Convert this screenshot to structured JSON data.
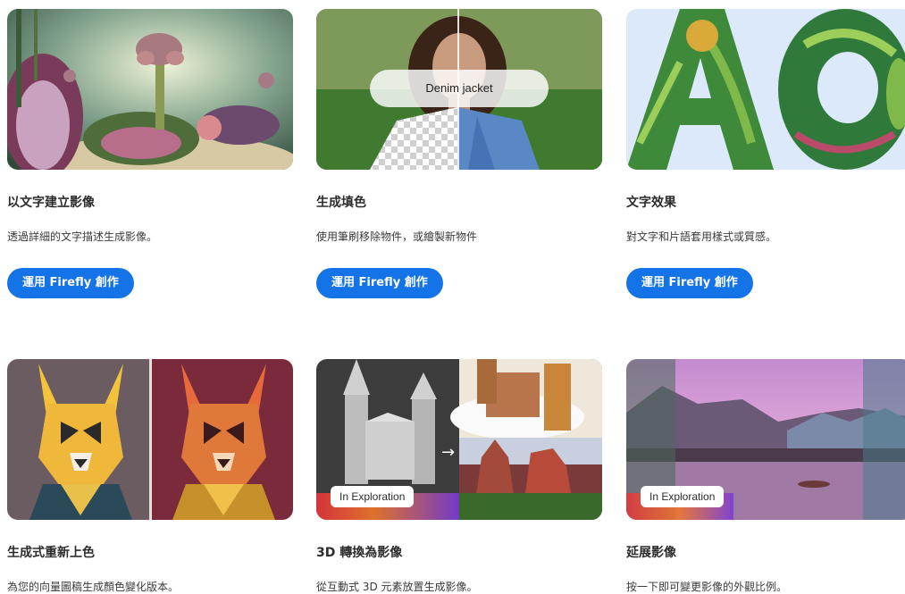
{
  "cards": [
    {
      "title": "以文字建立影像",
      "description": "透過詳細的文字描述生成影像。",
      "cta": "運用 Firefly 創作",
      "image": "fantasy-garden-illustration"
    },
    {
      "title": "生成填色",
      "description": "使用筆刷移除物件，或繪製新物件",
      "cta": "運用 Firefly 創作",
      "image": "woman-denim-jacket-split",
      "prompt_text": "Denim jacket"
    },
    {
      "title": "文字效果",
      "description": "對文字和片語套用樣式或質感。",
      "cta": "運用 Firefly 創作",
      "image": "leaf-textured-letters"
    },
    {
      "title": "生成式重新上色",
      "description": "為您的向量圖稿生成顏色變化版本。",
      "image": "geometric-dog-recolor"
    },
    {
      "title": "3D 轉換為影像",
      "description": "從互動式 3D 元素放置生成影像。",
      "badge": "In Exploration",
      "image": "3d-castle-to-image"
    },
    {
      "title": "延展影像",
      "description": "按一下即可變更影像的外觀比例。",
      "badge": "In Exploration",
      "image": "lake-landscape-expand"
    }
  ],
  "colors": {
    "accent_button": "#1473e6",
    "text_primary": "#2c2c2c"
  }
}
